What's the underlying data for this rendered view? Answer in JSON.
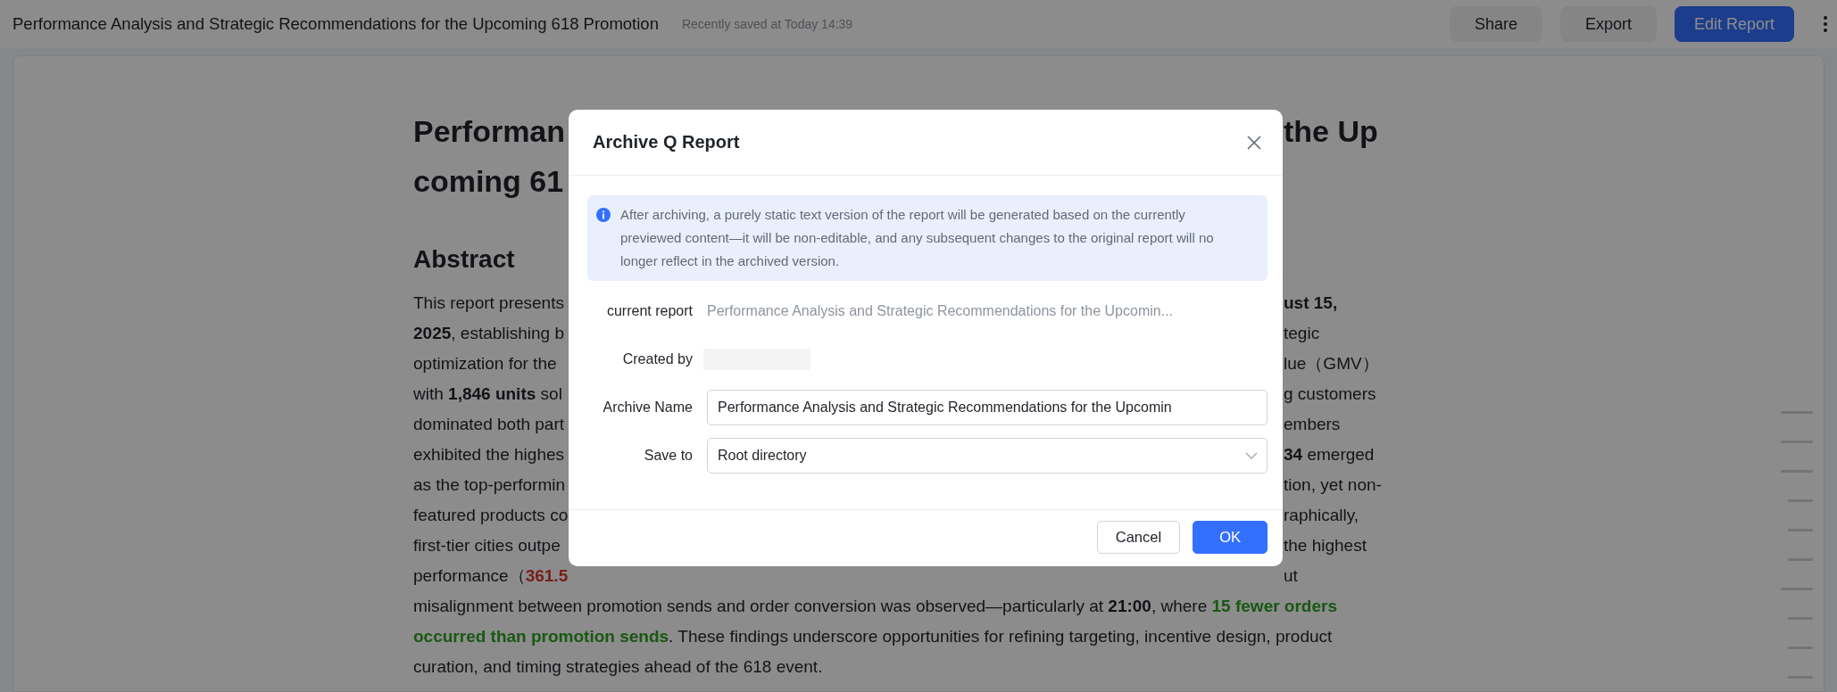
{
  "topbar": {
    "title": "Performance Analysis and Strategic Recommendations for the Upcoming 618 Promotion",
    "saved_status": "Recently saved at Today 14:39",
    "buttons": [
      {
        "label": "Share",
        "kind": "secondary"
      },
      {
        "label": "Export",
        "kind": "secondary"
      },
      {
        "label": "Edit Report",
        "kind": "primary"
      }
    ]
  },
  "document": {
    "title_lines": [
      {
        "left": "Performan",
        "right": "the Up"
      },
      {
        "left": "coming 61"
      }
    ],
    "heading": "Abstract",
    "lines": [
      {
        "left": [
          {
            "text": "This report presents",
            "kind": "normal"
          }
        ],
        "right": [
          {
            "text": "ust 15,",
            "kind": "strong"
          }
        ]
      },
      {
        "left": [
          {
            "text": "2025",
            "kind": "strong"
          },
          {
            "text": ", establishing b",
            "kind": "normal"
          }
        ],
        "right": [
          {
            "text": "tegic",
            "kind": "normal"
          }
        ]
      },
      {
        "left": [
          {
            "text": "optimization for the",
            "kind": "normal"
          }
        ],
        "right": [
          {
            "text": "lue（GMV）",
            "kind": "normal"
          }
        ]
      },
      {
        "left": [
          {
            "text": "with ",
            "kind": "normal"
          },
          {
            "text": "1,846 units",
            "kind": "strong"
          },
          {
            "text": " sol",
            "kind": "normal"
          }
        ],
        "right": [
          {
            "text": "g customers",
            "kind": "normal"
          }
        ]
      },
      {
        "left": [
          {
            "text": "dominated both part",
            "kind": "normal"
          }
        ],
        "right": [
          {
            "text": "embers",
            "kind": "normal"
          }
        ]
      },
      {
        "left": [
          {
            "text": "exhibited the highes",
            "kind": "normal"
          }
        ],
        "right": [
          {
            "text": "34",
            "kind": "strong"
          },
          {
            "text": " emerged",
            "kind": "normal"
          }
        ]
      },
      {
        "left": [
          {
            "text": "as the top-performin",
            "kind": "normal"
          }
        ],
        "right": [
          {
            "text": "tion, yet non-",
            "kind": "normal"
          }
        ]
      },
      {
        "left": [
          {
            "text": "featured products co",
            "kind": "normal"
          }
        ],
        "right": [
          {
            "text": "raphically,",
            "kind": "normal"
          }
        ]
      },
      {
        "left": [
          {
            "text": "first-tier cities outpe",
            "kind": "normal"
          }
        ],
        "right": [
          {
            "text": "the highest",
            "kind": "normal"
          }
        ]
      },
      {
        "left": [
          {
            "text": "performance（",
            "kind": "normal"
          },
          {
            "text": "361.5",
            "kind": "negative"
          }
        ],
        "right": [
          {
            "text": "ut",
            "kind": "normal"
          }
        ]
      },
      {
        "left": [
          {
            "text": "misalignment between promotion sends and order conversion was observed—particularly at ",
            "kind": "normal"
          },
          {
            "text": "21:00",
            "kind": "strong"
          },
          {
            "text": ", where ",
            "kind": "normal"
          },
          {
            "text": "15 fewer orders",
            "kind": "positive"
          }
        ]
      },
      {
        "left": [
          {
            "text": "occurred than promotion sends",
            "kind": "positive"
          },
          {
            "text": ". These findings underscore opportunities for refining targeting, incentive design, product",
            "kind": "normal"
          }
        ]
      },
      {
        "left": [
          {
            "text": "curation, and timing strategies ahead of the 618 event.",
            "kind": "normal"
          }
        ]
      }
    ]
  },
  "dialog": {
    "title": "Archive Q Report",
    "notice": "After archiving, a purely static text version of the report will be generated based on the currently previewed content—it will be non-editable, and any subsequent changes to the original report will no longer reflect in the archived version.",
    "fields": [
      {
        "label": "current report",
        "kind": "text",
        "value": "Performance Analysis and Strategic Recommendations for the Upcomin..."
      },
      {
        "label": "Created by",
        "kind": "redacted"
      },
      {
        "label": "Archive Name",
        "kind": "input",
        "value": "Performance Analysis and Strategic Recommendations for the Upcomin"
      },
      {
        "label": "Save to",
        "kind": "select",
        "value": "Root directory"
      }
    ],
    "buttons": [
      {
        "label": "Cancel",
        "kind": "default"
      },
      {
        "label": "OK",
        "kind": "primary"
      }
    ]
  }
}
